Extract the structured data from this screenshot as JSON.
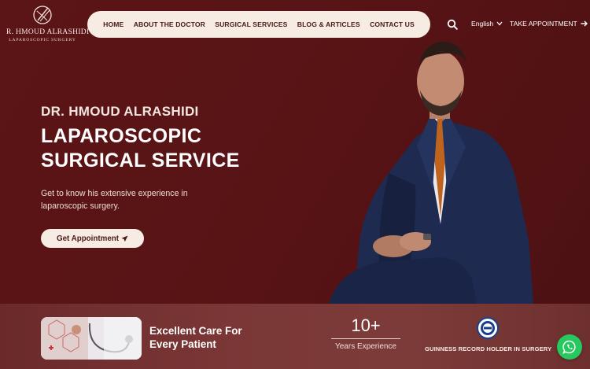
{
  "brand": {
    "name": "R. HMOUD ALRASHIDI",
    "subtitle": "LAPAROSCOPIC SURGERY"
  },
  "nav": {
    "items": [
      {
        "label": "HOME"
      },
      {
        "label": "ABOUT THE DOCTOR"
      },
      {
        "label": "SURGICAL SERVICES"
      },
      {
        "label": "BLOG & ARTICLES"
      },
      {
        "label": "CONTACT US"
      }
    ]
  },
  "header": {
    "search_icon": "search-icon",
    "language": "English",
    "appointment": "TAKE APPOINTMENT"
  },
  "hero": {
    "eyebrow": "DR. HMOUD ALRASHIDI",
    "title_line1": "LAPAROSCOPIC",
    "title_line2": "SURGICAL SERVICE",
    "description": "Get to know his extensive experience in laparoscopic surgery.",
    "cta": "Get Appointment"
  },
  "highlights": {
    "care_line1": "Excellent Care For",
    "care_line2": "Every Patient",
    "experience_number": "10+",
    "experience_label": "Years Experience",
    "guinness_label": "GUINNESS RECORD HOLDER IN SURGERY"
  },
  "colors": {
    "maroon": "#5a1416",
    "cream": "#f7ece3",
    "whatsapp": "#27c95f"
  }
}
